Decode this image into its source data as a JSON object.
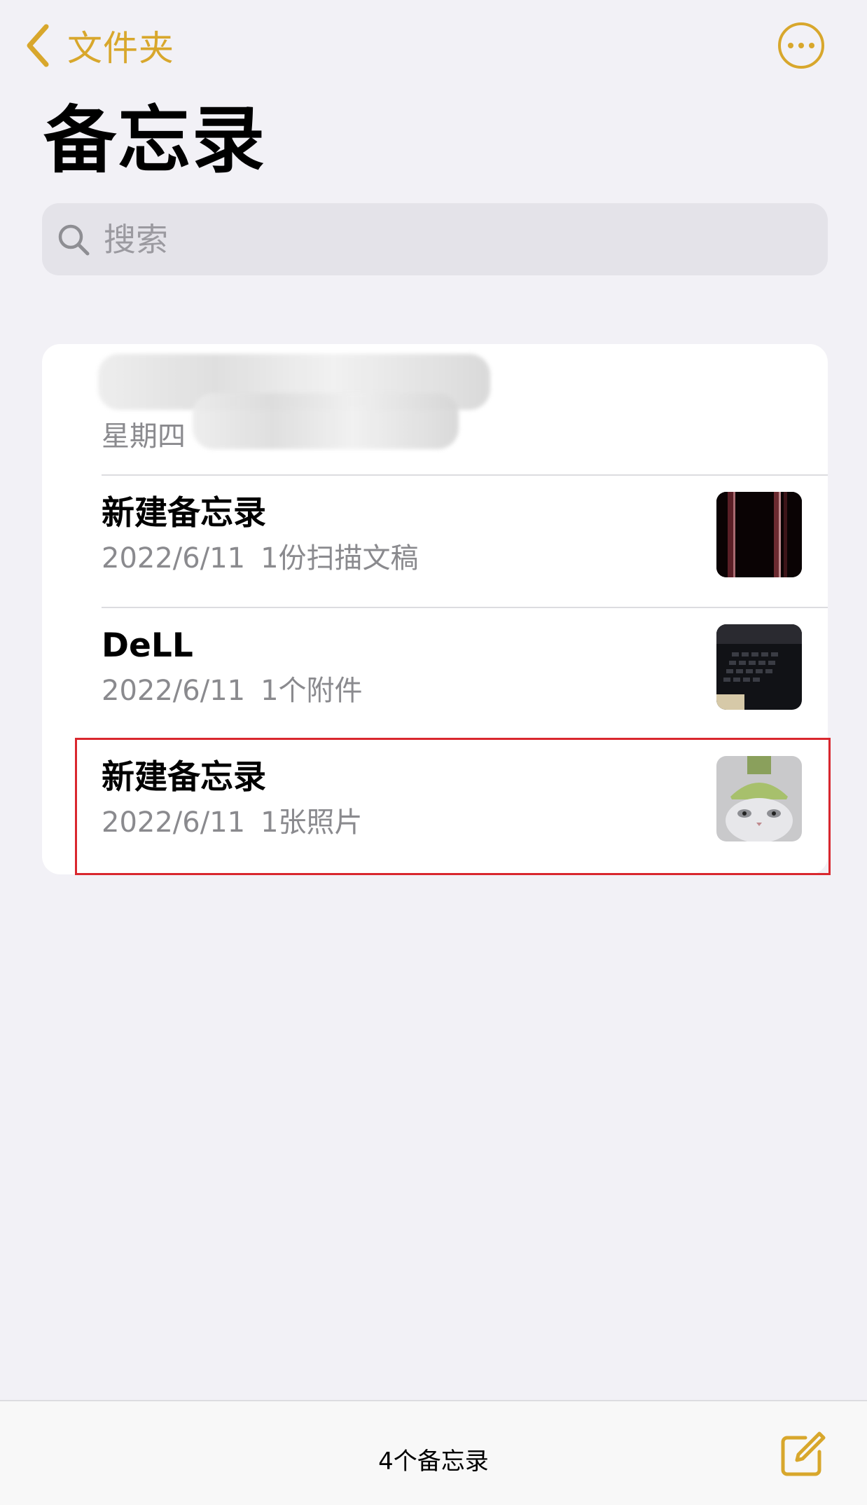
{
  "nav": {
    "back_label": "文件夹"
  },
  "title": "备忘录",
  "search": {
    "placeholder": "搜索"
  },
  "notes": [
    {
      "title": "",
      "date": "星期四",
      "detail": ""
    },
    {
      "title": "新建备忘录",
      "date": "2022/6/11",
      "detail": "1份扫描文稿",
      "thumb_icon": "scan-thumbnail"
    },
    {
      "title": "DeLL",
      "date": "2022/6/11",
      "detail": "1个附件",
      "thumb_icon": "laptop-keyboard-thumbnail"
    },
    {
      "title": "新建备忘录",
      "date": "2022/6/11",
      "detail": "1张照片",
      "thumb_icon": "cat-photo-thumbnail"
    }
  ],
  "footer": {
    "count_label": "4个备忘录"
  },
  "colors": {
    "accent": "#d8a72c",
    "background": "#f2f1f6",
    "highlight": "#d9272e"
  }
}
